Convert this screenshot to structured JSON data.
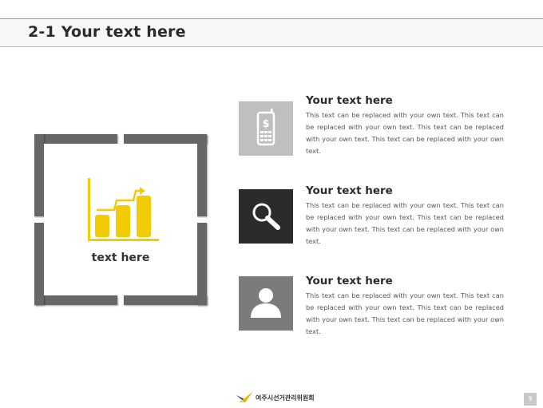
{
  "header": {
    "title": "2-1 Your text here"
  },
  "feature": {
    "caption": "text here",
    "icon": "bar-chart-icon",
    "accent": "#f2cb05"
  },
  "items": [
    {
      "icon": "mobile-phone-dollar-icon",
      "icon_bg": "#bfbfbf",
      "title": "Your text here",
      "body": "This text can be replaced with your own text. This text can be replaced with your own text. This text can be replaced with your own text. This text can be replaced with your own text."
    },
    {
      "icon": "search-icon",
      "icon_bg": "#2b2b2b",
      "title": "Your text here",
      "body": "This text can be replaced with your own text. This text can be replaced with your own text. This text can be replaced with your own text. This text can be replaced with your own text."
    },
    {
      "icon": "person-icon",
      "icon_bg": "#7b7b7b",
      "title": "Your text here",
      "body": "This text can be replaced with your own text. This text can be replaced with your own text. This text can be replaced with your own text. This text can be replaced with your own text."
    }
  ],
  "footer": {
    "organization": "여주시선거관리위원회",
    "page_number": "9"
  }
}
